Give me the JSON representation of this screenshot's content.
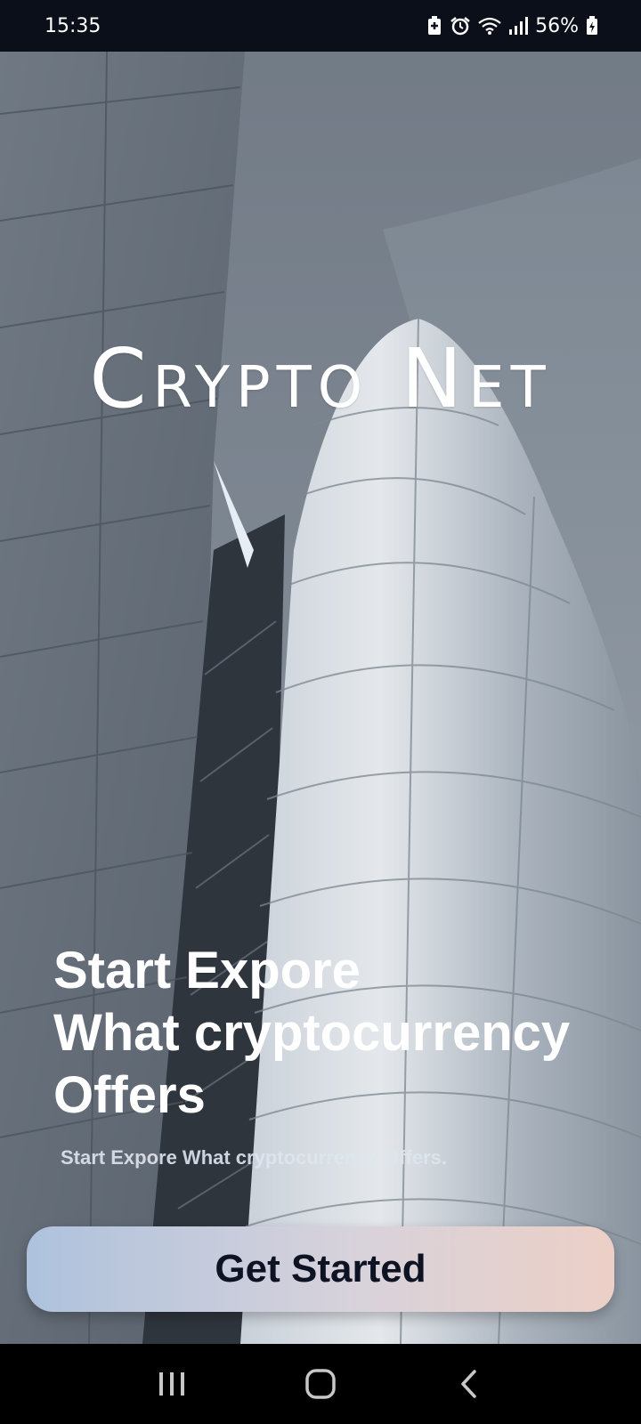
{
  "status_bar": {
    "time": "15:35",
    "battery": "56%",
    "icons": [
      "battery-saver-icon",
      "alarm-icon",
      "wifi-icon",
      "signal-icon",
      "battery-icon"
    ]
  },
  "app": {
    "logo": "Crypto Net"
  },
  "hero": {
    "headline_lines": [
      "Start Expore",
      "What cryptocurrency",
      "Offers"
    ],
    "subtitle": "Start Expore What cryptocurrency Offers."
  },
  "actions": {
    "get_started_label": "Get Started"
  },
  "nav_bar": {
    "buttons": [
      "recent-apps-icon",
      "home-icon",
      "back-icon"
    ]
  },
  "colors": {
    "button_gradient_start": "#aec2dd",
    "button_gradient_end": "#ecd0c7",
    "button_text": "#0e1324",
    "status_bg": "#0b0f1a"
  }
}
